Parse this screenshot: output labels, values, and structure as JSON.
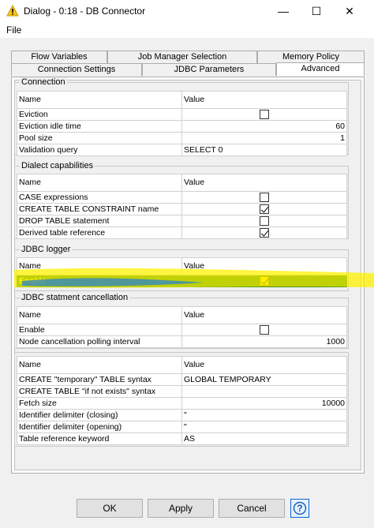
{
  "window": {
    "title": "Dialog - 0:18 - DB Connector",
    "min_glyph": "—",
    "max_glyph": "☐",
    "close_glyph": "✕"
  },
  "menu": {
    "file": "File"
  },
  "tabs": {
    "row1": [
      "Flow Variables",
      "Job Manager Selection",
      "Memory Policy"
    ],
    "row2": [
      "Connection Settings",
      "JDBC Parameters",
      "Advanced"
    ],
    "active": "Advanced"
  },
  "table_headers": {
    "name": "Name",
    "value": "Value"
  },
  "groups": {
    "connection": {
      "title": "Connection",
      "rows": [
        {
          "name": "Eviction",
          "type": "checkbox",
          "checked": false
        },
        {
          "name": "Eviction idle time",
          "type": "number",
          "value": "60"
        },
        {
          "name": "Pool size",
          "type": "number",
          "value": "1"
        },
        {
          "name": "Validation query",
          "type": "text",
          "value": "SELECT 0"
        }
      ]
    },
    "dialect": {
      "title": "Dialect capabilities",
      "rows": [
        {
          "name": "CASE expressions",
          "type": "checkbox",
          "checked": false
        },
        {
          "name": "CREATE TABLE CONSTRAINT name",
          "type": "checkbox",
          "checked": true
        },
        {
          "name": "DROP TABLE statement",
          "type": "checkbox",
          "checked": false
        },
        {
          "name": "Derived table reference",
          "type": "checkbox",
          "checked": true
        }
      ]
    },
    "jdbc_logger": {
      "title": "JDBC logger",
      "rows": [
        {
          "name": "Enable",
          "type": "checkbox",
          "checked": true,
          "selected": true
        }
      ]
    },
    "cancellation": {
      "title": "JDBC statment cancellation",
      "rows": [
        {
          "name": "Enable",
          "type": "checkbox",
          "checked": false
        },
        {
          "name": "Node cancellation polling interval",
          "type": "number",
          "value": "1000"
        }
      ]
    },
    "misc": {
      "rows": [
        {
          "name": "CREATE \"temporary\" TABLE syntax",
          "type": "text",
          "value": "GLOBAL TEMPORARY"
        },
        {
          "name": "CREATE TABLE \"if not exists\" syntax",
          "type": "text",
          "value": ""
        },
        {
          "name": "Fetch size",
          "type": "number",
          "value": "10000"
        },
        {
          "name": "Identifier delimiter (closing)",
          "type": "text",
          "value": "\""
        },
        {
          "name": "Identifier delimiter (opening)",
          "type": "text",
          "value": "\""
        },
        {
          "name": "Table reference keyword",
          "type": "text",
          "value": "AS"
        }
      ]
    }
  },
  "buttons": {
    "ok": "OK",
    "apply": "Apply",
    "cancel": "Cancel",
    "help": "?"
  },
  "colors": {
    "selection_bg": "#0a6f1c",
    "selection_text": "#ffea00",
    "highlighter": "#fff200",
    "highlighter_blue": "#1e7fd8"
  }
}
